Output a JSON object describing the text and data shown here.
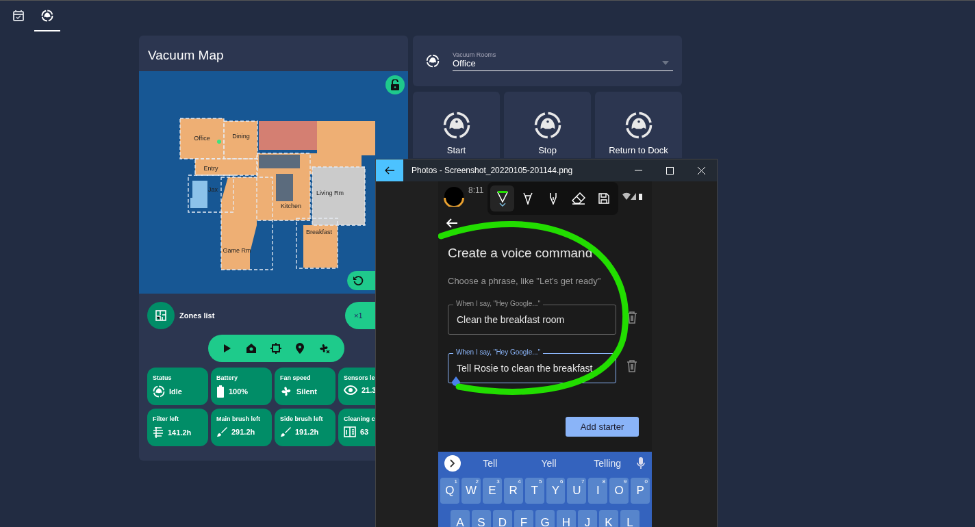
{
  "top_tabs": [
    {
      "kind": "calendar",
      "selected": false
    },
    {
      "kind": "robot",
      "selected": true
    }
  ],
  "map_card": {
    "title": "Vacuum Map",
    "rooms": [
      {
        "label": "Office"
      },
      {
        "label": "Dining"
      },
      {
        "label": "Entry"
      },
      {
        "label": "Jax"
      },
      {
        "label": "Kitchen"
      },
      {
        "label": "Living Rm"
      },
      {
        "label": "Breakfast"
      },
      {
        "label": "Game Rm"
      }
    ],
    "repeat": "×1"
  },
  "zones": {
    "label": "Zones list"
  },
  "stats": [
    {
      "kind": "robot",
      "label": "Status",
      "value": "Idle"
    },
    {
      "kind": "battery",
      "label": "Battery",
      "value": "100%"
    },
    {
      "kind": "fan",
      "label": "Fan speed",
      "value": "Silent"
    },
    {
      "kind": "eye",
      "label": "Sensors le",
      "value": "21.3"
    },
    {
      "kind": "filter",
      "label": "Filter left",
      "value": "141.2h"
    },
    {
      "kind": "brush",
      "label": "Main brush left",
      "value": "291.2h"
    },
    {
      "kind": "brush",
      "label": "Side brush left",
      "value": "191.2h"
    },
    {
      "kind": "counter",
      "label": "Cleaning c",
      "value": "63"
    }
  ],
  "room_select": {
    "label": "Vacuum Rooms",
    "value": "Office"
  },
  "actions": [
    {
      "label": "Start"
    },
    {
      "label": "Stop"
    },
    {
      "label": "Return to Dock"
    }
  ],
  "photos_window": {
    "title": "Photos - Screenshot_20220105-201144.png",
    "phone": {
      "time": "8:11",
      "tools": [
        {
          "kind": "pen",
          "selected": true
        },
        {
          "kind": "marker",
          "selected": false
        },
        {
          "kind": "nib",
          "selected": false
        },
        {
          "kind": "eraser",
          "selected": false
        },
        {
          "kind": "save",
          "selected": false
        }
      ],
      "heading": "Create a voice command",
      "hint": "Choose a phrase, like \"Let's get ready\"",
      "fields": [
        {
          "label": "When I say, \"Hey Google...\"",
          "value": "Clean the breakfast room",
          "focused": false
        },
        {
          "label": "When I say, \"Hey Google...\"",
          "value": "Tell Rosie to clean the breakfast",
          "focused": true
        }
      ],
      "button": "Add starter",
      "suggestions": [
        "Tell",
        "Yell",
        "Telling"
      ],
      "keys": [
        [
          {
            "key": "Q",
            "digit": "1"
          },
          {
            "key": "W",
            "digit": "2"
          },
          {
            "key": "E",
            "digit": "3"
          },
          {
            "key": "R",
            "digit": "4"
          },
          {
            "key": "T",
            "digit": "5"
          },
          {
            "key": "Y",
            "digit": "6"
          },
          {
            "key": "U",
            "digit": "7"
          },
          {
            "key": "I",
            "digit": "8"
          },
          {
            "key": "O",
            "digit": "9"
          },
          {
            "key": "P",
            "digit": "0"
          }
        ],
        [
          {
            "key": "A"
          },
          {
            "key": "S"
          },
          {
            "key": "D"
          },
          {
            "key": "F"
          },
          {
            "key": "G"
          },
          {
            "key": "H"
          },
          {
            "key": "J"
          },
          {
            "key": "K"
          },
          {
            "key": "L"
          }
        ]
      ]
    }
  }
}
